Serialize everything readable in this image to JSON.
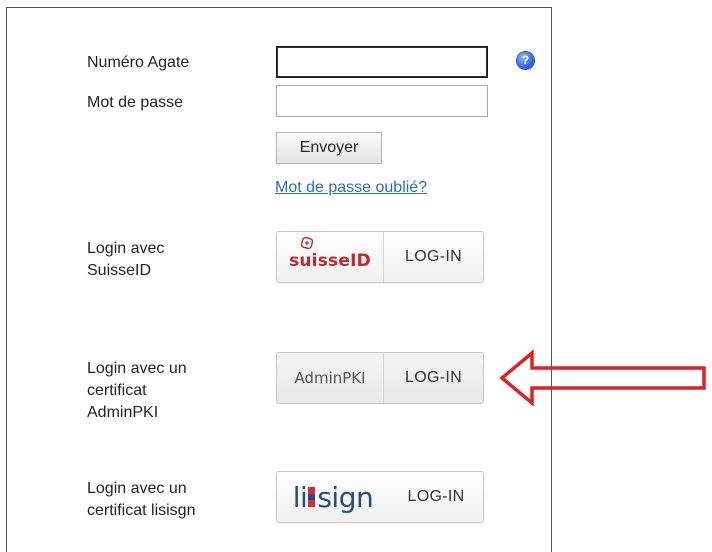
{
  "form": {
    "agate_label": "Numéro Agate",
    "agate_value": "",
    "password_label": "Mot de passe",
    "password_value": "",
    "help_icon": "question-circle-icon",
    "send_button": "Envoyer",
    "forgot_link": "Mot de passe oublié?"
  },
  "logins": [
    {
      "label_lines": [
        "Login avec",
        "SuisseID"
      ],
      "brand": "suisseID",
      "button_text": "LOG-IN"
    },
    {
      "label_lines": [
        "Login avec un",
        "certificat",
        "AdminPKI"
      ],
      "brand": "AdminPKI",
      "button_text": "LOG-IN"
    },
    {
      "label_lines": [
        "Login avec un",
        "certificat lisisgn"
      ],
      "brand": "lisign",
      "button_text": "LOG-IN"
    }
  ],
  "annotation": {
    "arrow_icon": "red-left-arrow-icon",
    "arrow_color": "#e02020"
  },
  "colors": {
    "suisse_red": "#c0282c",
    "lisign_blue": "#2a4c86",
    "link_blue": "#2a6cc4"
  }
}
